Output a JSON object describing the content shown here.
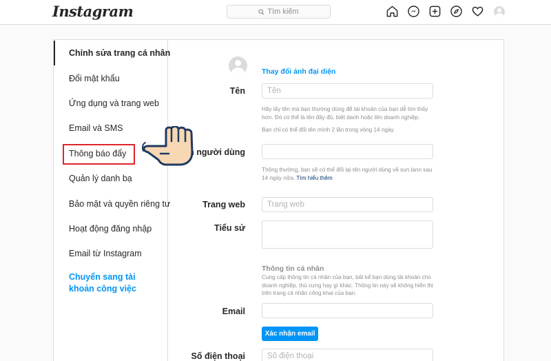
{
  "brand": {
    "logo": "Instagram"
  },
  "search": {
    "placeholder": "Tìm kiếm"
  },
  "nav_icons": [
    "home-icon",
    "messenger-icon",
    "new-post-icon",
    "explore-icon",
    "activity-heart-icon",
    "profile-avatar"
  ],
  "sidebar": {
    "items": [
      {
        "label": "Chỉnh sửa trang cá nhân",
        "active": true
      },
      {
        "label": "Đổi mật khẩu"
      },
      {
        "label": "Ứng dụng và trang web"
      },
      {
        "label": "Email và SMS"
      },
      {
        "label": "Thông báo đẩy",
        "highlighted": true
      },
      {
        "label": "Quản lý danh bạ"
      },
      {
        "label": "Bảo mật và quyền riêng tư"
      },
      {
        "label": "Hoạt động đăng nhập"
      },
      {
        "label": "Email từ Instagram"
      }
    ],
    "switch_account": "Chuyển sang tài khoản công việc"
  },
  "form": {
    "change_photo": "Thay đổi ảnh đại diện",
    "name": {
      "label": "Tên",
      "placeholder": "Tên",
      "help1": "Hãy lấy tên mà bạn thường dùng để tài khoản của bạn dễ tìm thấy hơn. Đó có thể là tên đầy đủ, biệt danh hoặc tên doanh nghiệp.",
      "help2": "Bạn chỉ có thể đổi tên mình 2 lần trong vòng 14 ngày."
    },
    "username": {
      "label": "Tên người dùng",
      "value": "",
      "help": "Thông thường, bạn sẽ có thể đổi lại tên người dùng về sun.lann sau 14 ngày nữa.",
      "learn_more": "Tìm hiểu thêm"
    },
    "website": {
      "label": "Trang web",
      "placeholder": "Trang web"
    },
    "bio": {
      "label": "Tiểu sử",
      "value": ""
    },
    "personal_info": {
      "title": "Thông tin cá nhân",
      "desc": "Cung cấp thông tin cá nhân của bạn, bất kể bạn dùng tài khoản cho doanh nghiệp, thú cưng hay gì khác. Thông tin này sẽ không hiển thị trên trang cá nhân công khai của bạn."
    },
    "email": {
      "label": "Email",
      "value": ""
    },
    "confirm_email": "Xác nhận email",
    "phone": {
      "label": "Số điện thoại",
      "placeholder": "Số điện thoại"
    }
  },
  "colors": {
    "accent": "#0095f6",
    "highlight_box": "#e0242b",
    "hand_skin": "#f7d7b4",
    "hand_outline": "#1f3a5f"
  }
}
